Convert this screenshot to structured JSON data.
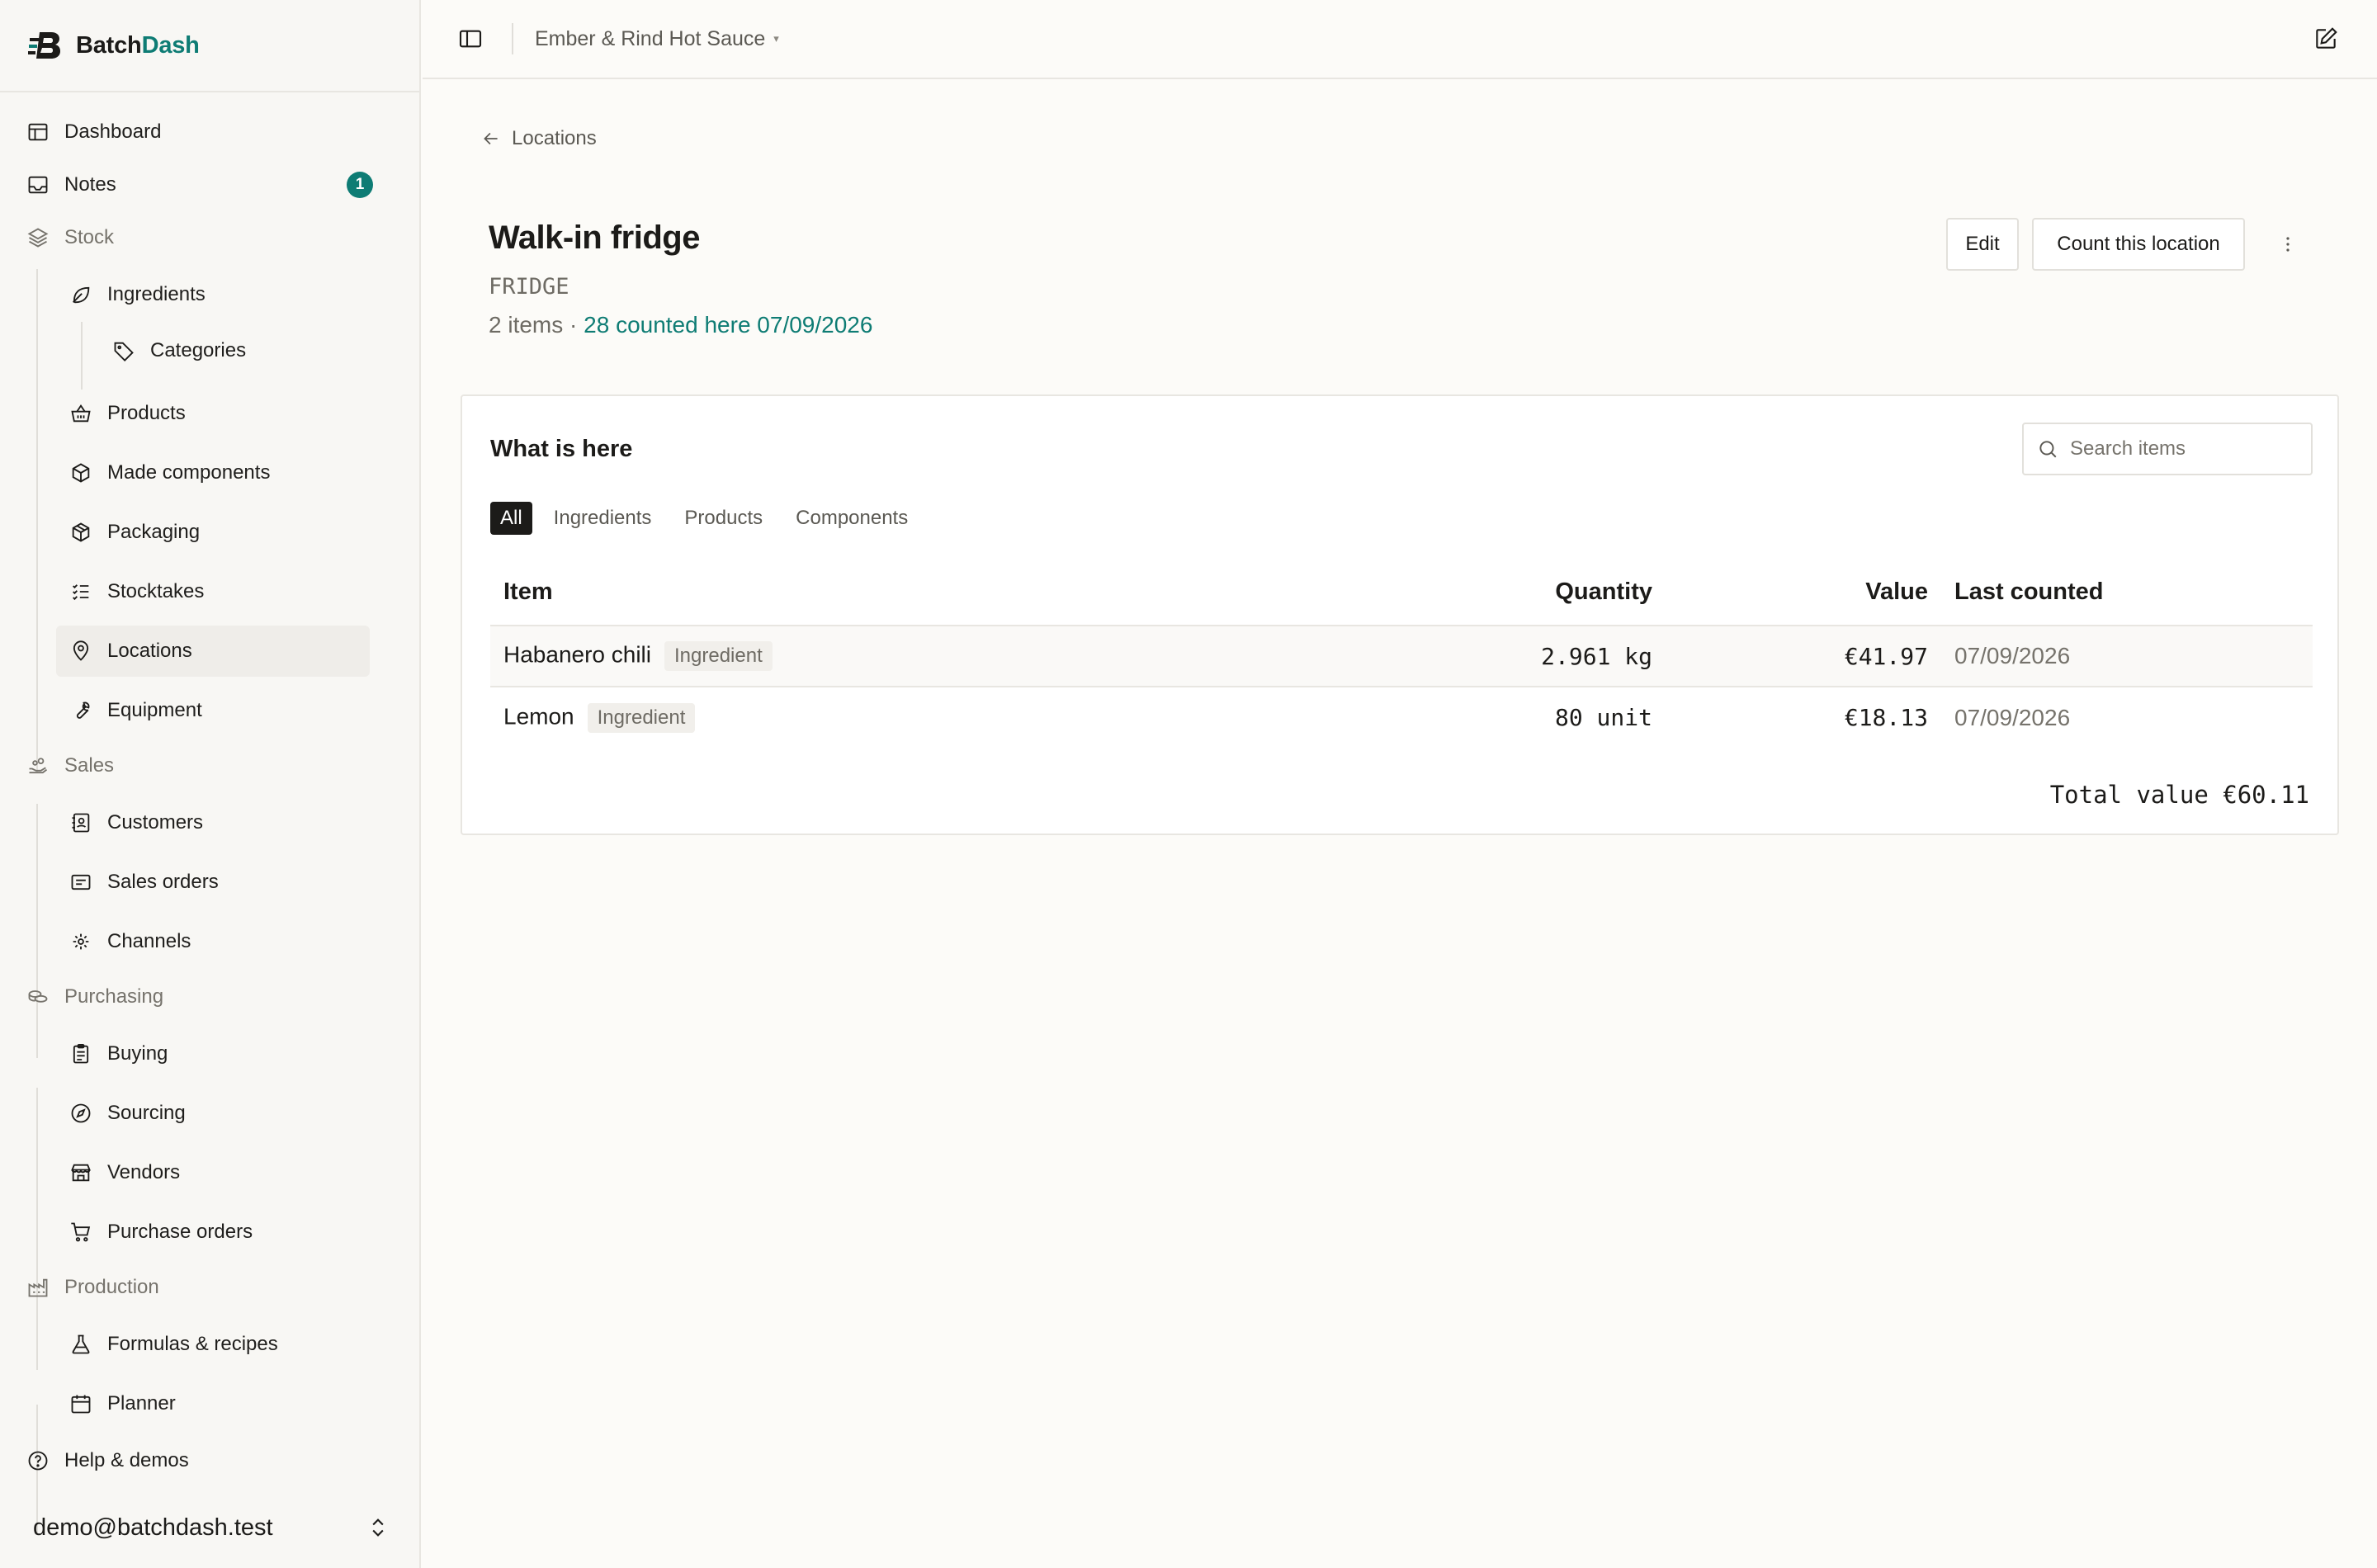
{
  "brand": {
    "name_part1": "Batch",
    "name_part2": "Dash"
  },
  "nav": {
    "dashboard": "Dashboard",
    "notes": "Notes",
    "notes_badge": "1",
    "stock": "Stock",
    "ingredients": "Ingredients",
    "categories": "Categories",
    "products": "Products",
    "made_components": "Made components",
    "packaging": "Packaging",
    "stocktakes": "Stocktakes",
    "locations": "Locations",
    "equipment": "Equipment",
    "sales": "Sales",
    "customers": "Customers",
    "sales_orders": "Sales orders",
    "channels": "Channels",
    "purchasing": "Purchasing",
    "buying": "Buying",
    "sourcing": "Sourcing",
    "vendors": "Vendors",
    "purchase_orders": "Purchase orders",
    "production": "Production",
    "formulas": "Formulas & recipes",
    "planner": "Planner",
    "help": "Help & demos"
  },
  "user": {
    "email": "demo@batchdash.test"
  },
  "header": {
    "workspace": "Ember & Rind Hot Sauce",
    "caret": "▾"
  },
  "page": {
    "back_label": "Locations",
    "title": "Walk-in fridge",
    "code": "FRIDGE",
    "items_count": "2 items · ",
    "counted_link": "28 counted here 07/09/2026",
    "edit_label": "Edit",
    "count_label": "Count this location"
  },
  "card": {
    "title": "What is here",
    "search_placeholder": "Search items",
    "tabs": [
      "All",
      "Ingredients",
      "Products",
      "Components"
    ],
    "columns": {
      "item": "Item",
      "quantity": "Quantity",
      "value": "Value",
      "last": "Last counted"
    },
    "rows": [
      {
        "name": "Habanero chili",
        "type": "Ingredient",
        "quantity": "2.961 kg",
        "value": "€41.97",
        "last": "07/09/2026"
      },
      {
        "name": "Lemon",
        "type": "Ingredient",
        "quantity": "80 unit",
        "value": "€18.13",
        "last": "07/09/2026"
      }
    ],
    "total": "Total value €60.11"
  },
  "colors": {
    "accent": "#0e7c74",
    "text": "#1c1b19",
    "muted": "#76736c"
  }
}
